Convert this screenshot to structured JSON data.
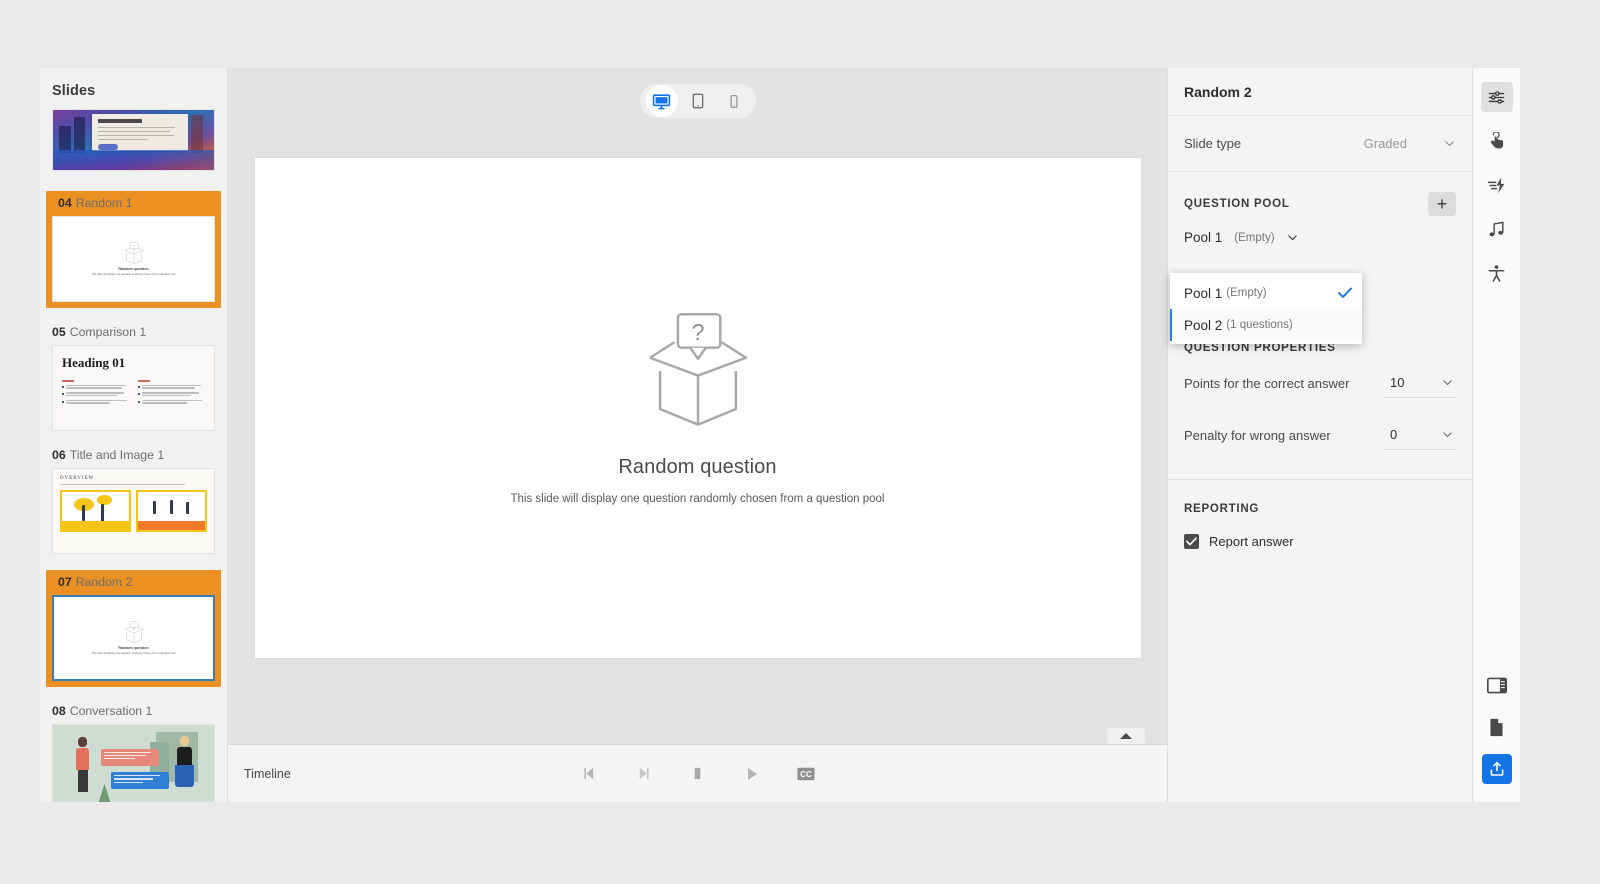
{
  "app": {
    "slides_panel_title": "Slides",
    "canvas": {
      "title": "Random question",
      "subtitle": "This slide will display one question randomly chosen from a question pool",
      "placeholder_icon": "open-box-question-icon"
    },
    "device_toggle": {
      "options": [
        {
          "id": "desktop",
          "icon": "desktop-monitor-icon",
          "selected": true
        },
        {
          "id": "tablet",
          "icon": "tablet-icon",
          "selected": false
        },
        {
          "id": "mobile",
          "icon": "mobile-phone-icon",
          "selected": false
        }
      ]
    },
    "timeline": {
      "label": "Timeline",
      "controls": [
        {
          "id": "previous-frame",
          "icon": "step-backward-icon"
        },
        {
          "id": "next-frame",
          "icon": "step-forward-icon"
        },
        {
          "id": "stop",
          "icon": "stop-icon"
        },
        {
          "id": "play",
          "icon": "play-icon"
        },
        {
          "id": "closed-captions",
          "icon": "cc-icon",
          "label": "CC"
        }
      ],
      "collapse_icon": "caret-up-icon"
    }
  },
  "slides": [
    {
      "number": "",
      "name": "",
      "thumb": "city",
      "selected": false,
      "active": false,
      "partial": true
    },
    {
      "number": "04",
      "name": "Random 1",
      "thumb": "random",
      "selected": true,
      "active": false,
      "mini_title": "Random question",
      "mini_sub": "This slide will display one question randomly chosen from a question pool"
    },
    {
      "number": "05",
      "name": "Comparison 1",
      "thumb": "comparison",
      "selected": false,
      "active": false,
      "heading": "Heading 01"
    },
    {
      "number": "06",
      "name": "Title and Image 1",
      "thumb": "title-image",
      "selected": false,
      "active": false,
      "overview": "OVERVIEW"
    },
    {
      "number": "07",
      "name": "Random 2",
      "thumb": "random",
      "selected": true,
      "active": true,
      "mini_title": "Random question",
      "mini_sub": "This slide will display one question randomly chosen from a question pool"
    },
    {
      "number": "08",
      "name": "Conversation 1",
      "thumb": "conversation",
      "selected": false,
      "active": false
    }
  ],
  "properties": {
    "header_title": "Random 2",
    "slide_type": {
      "label": "Slide type",
      "value": "Graded",
      "chevron_icon": "chevron-down-icon"
    },
    "question_pool": {
      "section_label": "QUESTION POOL",
      "add_label": "+",
      "selected_name": "Pool 1",
      "selected_count": "(Empty)",
      "chevron_icon": "chevron-down-icon",
      "dropdown_open": true,
      "options": [
        {
          "name": "Pool 1",
          "count": "(Empty)",
          "checked": true,
          "hover": false
        },
        {
          "name": "Pool 2",
          "count": "(1 questions)",
          "checked": false,
          "hover": true
        }
      ],
      "check_icon": "checkmark-icon"
    },
    "question_properties": {
      "section_label": "QUESTION PROPERTIES",
      "rows": [
        {
          "label": "Points for the correct answer",
          "value": "10",
          "chevron_icon": "chevron-down-icon"
        },
        {
          "label": "Penalty for wrong answer",
          "value": "0",
          "chevron_icon": "chevron-down-icon"
        }
      ]
    },
    "reporting": {
      "section_label": "REPORTING",
      "checkbox_label": "Report answer",
      "checked": true
    }
  },
  "rail": {
    "top_items": [
      {
        "id": "properties",
        "icon": "sliders-properties-icon",
        "active": true
      },
      {
        "id": "interactions",
        "icon": "hand-click-icon",
        "active": false
      },
      {
        "id": "animations",
        "icon": "lightning-motion-icon",
        "active": false
      },
      {
        "id": "audio",
        "icon": "music-note-icon",
        "active": false
      },
      {
        "id": "accessibility",
        "icon": "accessibility-person-icon",
        "active": false
      }
    ],
    "bottom_items": [
      {
        "id": "layout",
        "icon": "panel-layout-icon",
        "active": false
      },
      {
        "id": "assets",
        "icon": "document-page-icon",
        "active": false
      },
      {
        "id": "publish",
        "icon": "publish-upload-icon",
        "active": false,
        "primary": true
      }
    ]
  },
  "colors": {
    "selection_orange": "#eb9123",
    "active_blue": "#3a7cba",
    "accent_blue": "#1473e6",
    "panel_bg": "#f4f4f4",
    "stage_bg": "#e3e3e3"
  }
}
